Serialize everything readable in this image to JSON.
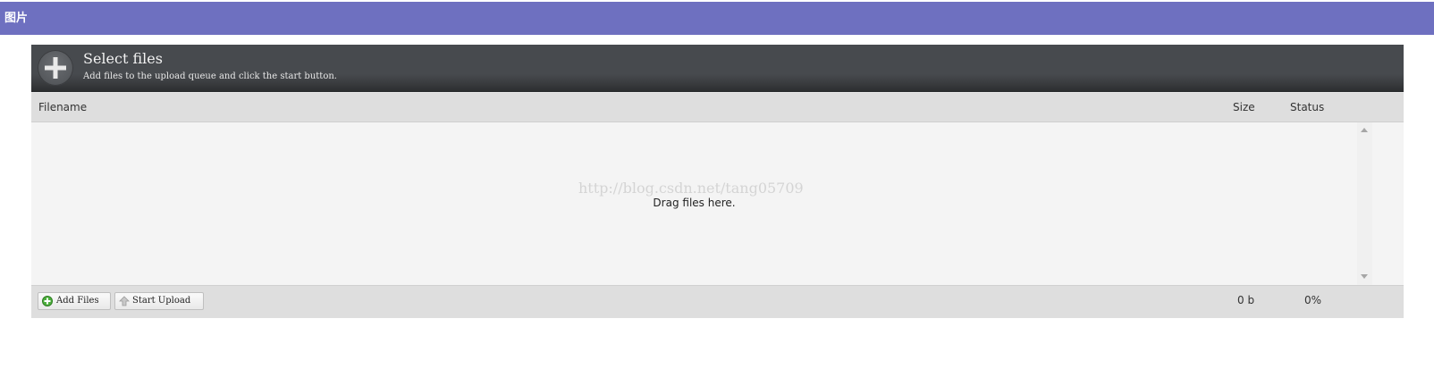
{
  "panel": {
    "title": "图片"
  },
  "uploader": {
    "title": "Select files",
    "subtitle": "Add files to the upload queue and click the start button.",
    "icons": {
      "add": "plus-circle-icon"
    },
    "columns": {
      "filename": "Filename",
      "size": "Size",
      "status": "Status"
    },
    "drop_text": "Drag files here.",
    "watermark": "http://blog.csdn.net/tang05709",
    "buttons": {
      "add_files": "Add Files",
      "start_upload": "Start Upload"
    },
    "button_icons": {
      "add_files": "green-plus-icon",
      "start_upload": "up-arrow-icon"
    },
    "totals": {
      "size": "0 b",
      "status": "0%"
    },
    "colors": {
      "header_bar": "#6e70c0",
      "uploader_header": "#474a4e",
      "list_bg": "#f4f4f4",
      "footer_bg": "#dedede"
    }
  }
}
